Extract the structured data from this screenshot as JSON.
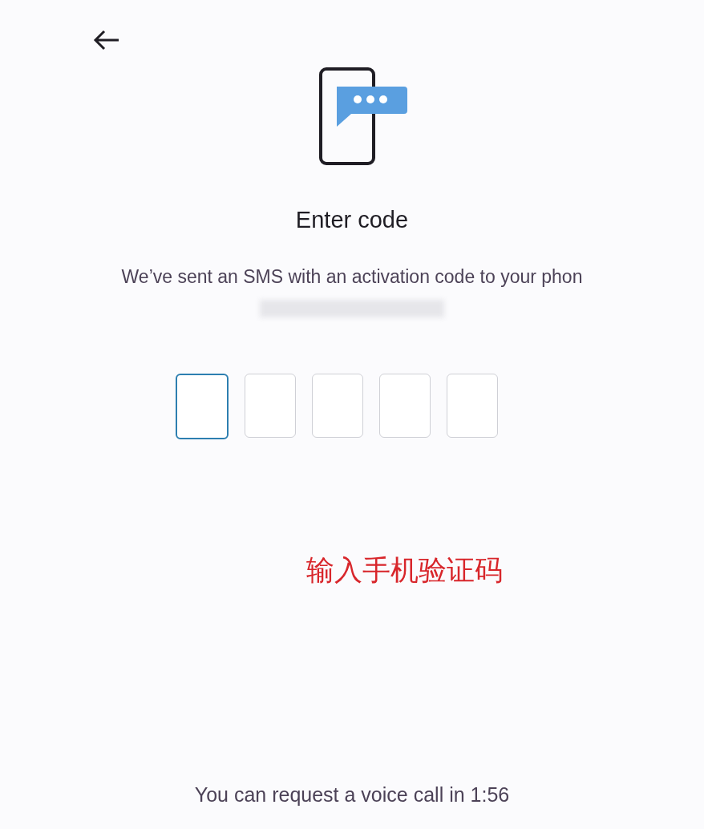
{
  "title": "Enter code",
  "message": "We’ve sent an SMS with an activation code to your phon",
  "code_boxes": [
    {
      "focused": true
    },
    {
      "focused": false
    },
    {
      "focused": false
    },
    {
      "focused": false
    },
    {
      "focused": false
    }
  ],
  "annotation": {
    "text": "输入手机验证码",
    "color": "#d8262b"
  },
  "footer": "You can request a voice call in 1:56"
}
